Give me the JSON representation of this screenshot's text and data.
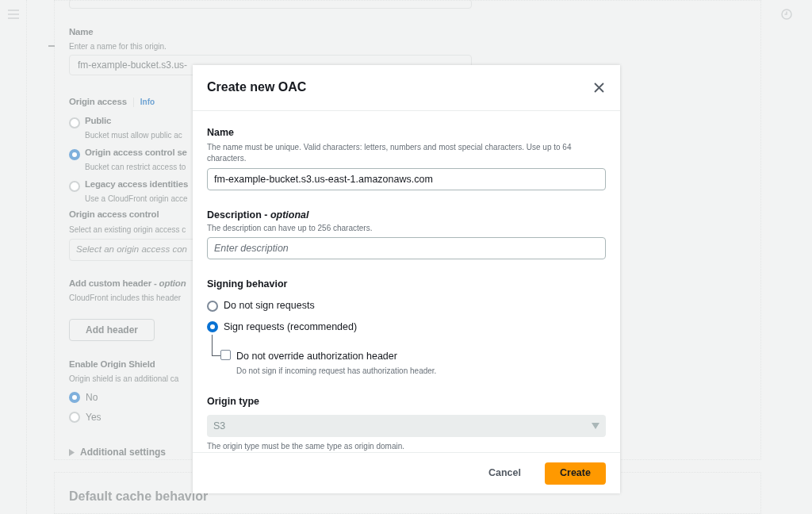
{
  "background": {
    "name": {
      "label": "Name",
      "hint": "Enter a name for this origin.",
      "value": "fm-example-bucket.s3.us-"
    },
    "origin_access": {
      "label": "Origin access",
      "info": "Info",
      "options": [
        {
          "label": "Public",
          "hint": "Bucket must allow public ac",
          "selected": false
        },
        {
          "label": "Origin access control se",
          "hint": "Bucket can restrict access to",
          "selected": true
        },
        {
          "label": "Legacy access identities",
          "hint": "Use a CloudFront origin acce",
          "selected": false
        }
      ]
    },
    "origin_access_control": {
      "label": "Origin access control",
      "hint": "Select an existing origin access c",
      "placeholder": "Select an origin access con"
    },
    "custom_header": {
      "label": "Add custom header - *option*",
      "hint": "CloudFront includes this header",
      "button": "Add header"
    },
    "origin_shield": {
      "label": "Enable Origin Shield",
      "hint": "Origin shield is an additional ca",
      "options": [
        {
          "label": "No",
          "selected": true
        },
        {
          "label": "Yes",
          "selected": false
        }
      ]
    },
    "additional_settings": "Additional settings",
    "next_section": "Default cache behavior"
  },
  "modal": {
    "title": "Create new OAC",
    "name": {
      "label": "Name",
      "hint": "The name must be unique. Valid characters: letters, numbers and most special characters. Use up to 64 characters.",
      "value": "fm-example-bucket.s3.us-east-1.amazonaws.com"
    },
    "description": {
      "label": "Description - *optional*",
      "hint": "The description can have up to 256 characters.",
      "placeholder": "Enter description"
    },
    "signing": {
      "label": "Signing behavior",
      "options": [
        {
          "label": "Do not sign requests",
          "selected": false
        },
        {
          "label": "Sign requests (recommended)",
          "selected": true
        }
      ],
      "sub_option": {
        "label": "Do not override authorization header",
        "hint": "Do not sign if incoming request has authorization header.",
        "checked": false
      }
    },
    "origin_type": {
      "label": "Origin type",
      "value": "S3",
      "hint": "The origin type must be the same type as origin domain.",
      "disabled": true
    },
    "buttons": {
      "cancel": "Cancel",
      "create": "Create"
    }
  }
}
